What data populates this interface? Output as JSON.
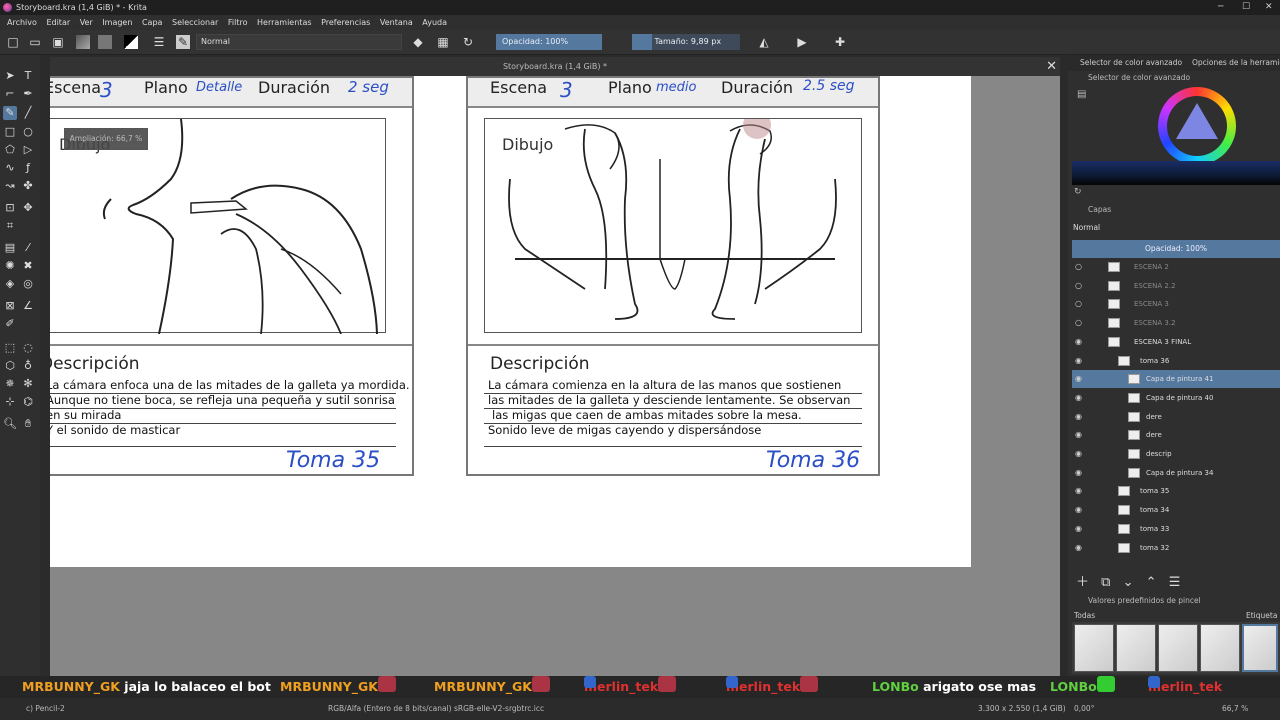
{
  "window": {
    "title": "Storyboard.kra (1,4 GiB) * - Krita"
  },
  "menu": [
    "Archivo",
    "Editar",
    "Ver",
    "Imagen",
    "Capa",
    "Seleccionar",
    "Filtro",
    "Herramientas",
    "Preferencias",
    "Ventana",
    "Ayuda"
  ],
  "toolbar": {
    "blend_mode": "Normal",
    "opacity": "Opacidad: 100%",
    "size": "Tamaño: 9,89 px"
  },
  "document": {
    "tab_title": "Storyboard.kra (1,4 GiB) *",
    "zoom_tooltip": "Ampliación: 66,7 %"
  },
  "panels": [
    {
      "escena_label": "Escena",
      "escena_value": "3",
      "plano_label": "Plano",
      "plano_value": "Detalle",
      "duracion_label": "Duración",
      "duracion_value": "2 seg",
      "dibujo": "Dibujo",
      "desc_title": "Descripción",
      "desc_lines": [
        "La cámara enfoca una de las mitades de la galleta ya mordida.",
        "Aunque no tiene boca, se refleja una pequeña y sutil sonrisa",
        "en su mirada",
        "Y el sonido de masticar"
      ],
      "toma": "Toma 35"
    },
    {
      "escena_label": "Escena",
      "escena_value": "3",
      "plano_label": "Plano",
      "plano_value": "medio",
      "duracion_label": "Duración",
      "duracion_value": "2.5 seg",
      "dibujo": "Dibujo",
      "desc_title": "Descripción",
      "desc_lines": [
        "La cámara comienza en la altura de las manos que sostienen",
        "las mitades de la galleta y desciende lentamente. Se observan",
        "las migas que caen de ambas mitades sobre la mesa.",
        "Sonido leve de migas cayendo y dispersándose"
      ],
      "toma": "Toma 36"
    }
  ],
  "dock": {
    "tab1": "Selector de color avanzado",
    "tab2": "Opciones de la herramienta",
    "color_title": "Selector de color avanzado",
    "layers_title": "Capas",
    "layers_blend": "Normal",
    "layers_opacity": "Opacidad: 100%",
    "layers": [
      {
        "name": "ESCENA 2",
        "dim": true
      },
      {
        "name": "ESCENA 2.2",
        "dim": true
      },
      {
        "name": "ESCENA 3",
        "dim": true
      },
      {
        "name": "ESCENA 3.2",
        "dim": true
      },
      {
        "name": "ESCENA 3 FINAL",
        "dim": false
      },
      {
        "name": "toma 36",
        "dim": false
      },
      {
        "name": "Capa de pintura 41",
        "dim": false,
        "selected": true
      },
      {
        "name": "Capa de pintura 40",
        "dim": false
      },
      {
        "name": "dere",
        "dim": false
      },
      {
        "name": "dere",
        "dim": false
      },
      {
        "name": "descrip",
        "dim": false
      },
      {
        "name": "Capa de pintura 34",
        "dim": false
      },
      {
        "name": "toma 35",
        "dim": false
      },
      {
        "name": "toma 34",
        "dim": false
      },
      {
        "name": "toma 33",
        "dim": false
      },
      {
        "name": "toma 32",
        "dim": false
      }
    ],
    "presets_title": "Valores predefinidos de pincel",
    "presets_filter": "Todas",
    "presets_tag": "Etiqueta"
  },
  "chat": [
    {
      "user": "MRBUNNY_GK",
      "msg": "jaja lo balaceo el bot",
      "color": "#f0a020"
    },
    {
      "user": "MRBUNNY_GK",
      "msg": "",
      "color": "#f0a020"
    },
    {
      "user": "MRBUNNY_GK",
      "msg": "",
      "color": "#f0a020"
    },
    {
      "user": "merlin_tek",
      "msg": "",
      "color": "#e03030"
    },
    {
      "user": "merlin_tek",
      "msg": "",
      "color": "#e03030"
    },
    {
      "user": "LONBo",
      "msg": "arigato ose mas",
      "color": "#60d040"
    },
    {
      "user": "LONBo",
      "msg": "",
      "color": "#60d040"
    },
    {
      "user": "merlin_tek",
      "msg": "",
      "color": "#e03030"
    }
  ],
  "status": {
    "brush": "c) Pencil-2",
    "colorspace": "RGB/Alfa (Entero de 8 bits/canal)  sRGB-elle-V2-srgbtrc.icc",
    "dimensions": "3.300 x 2.550 (1,4 GiB)",
    "rotation": "0,00°",
    "zoom": "66,7 %"
  }
}
